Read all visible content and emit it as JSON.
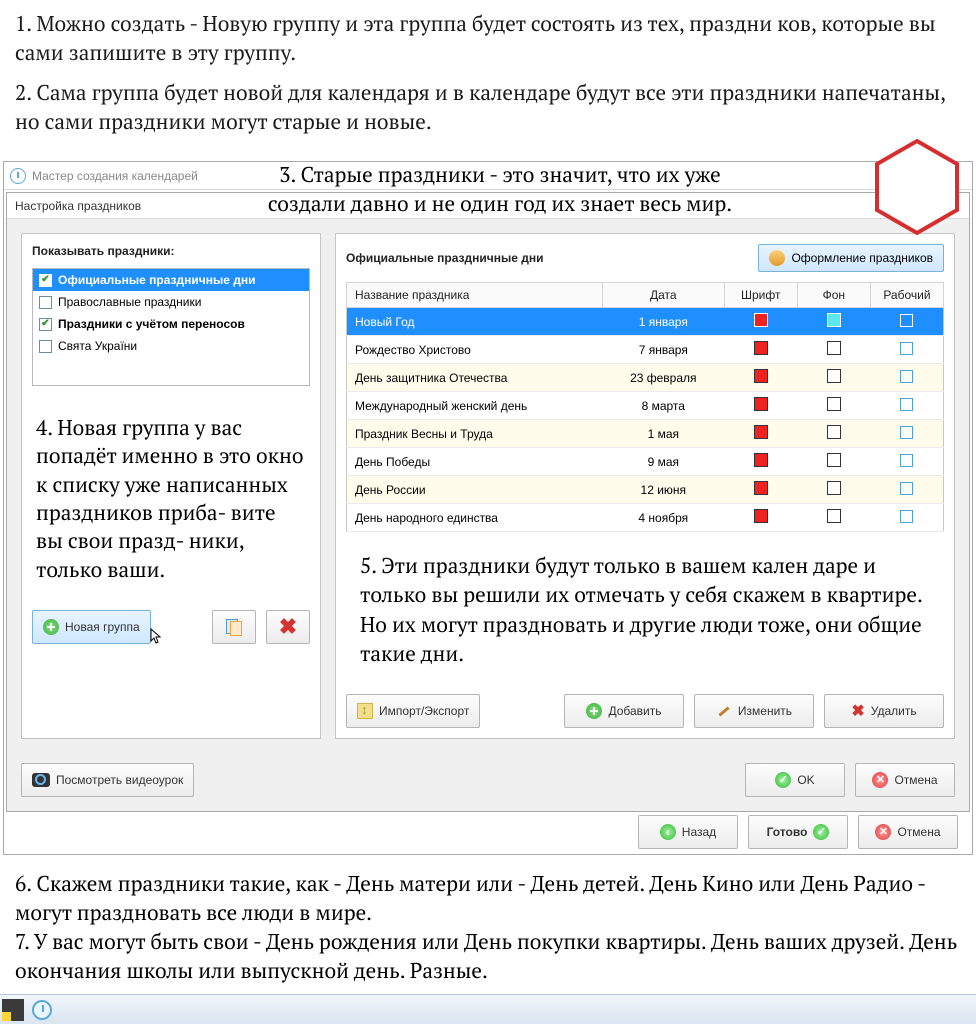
{
  "notes": {
    "n1": "1. Можно создать - Новую группу и эта группа будет состоять из тех, праздни ков, которые вы сами запишите в эту группу.",
    "n2": "2. Сама группа будет новой для календаря и в календаре будут все эти праздники напечатаны, но сами праздники могут старые и новые.",
    "n3a": "3. Старые праздники - это значит, что их уже",
    "n3b": "создали давно и не один год их знает весь мир.",
    "n4": "4. Новая группа у вас попадёт именно в это окно к списку уже написанных праздников приба- вите вы свои празд- ники, только ваши.",
    "n5": "5. Эти праздники будут только в вашем кален даре и только вы решили их отмечать у себя скажем в квартире. Но их могут праздновать и другие люди тоже, они общие такие дни.",
    "n6": "6. Скажем праздники такие, как - День матери или - День детей. День Кино или День Радио - могут праздновать все люди в мире.",
    "n7": "7. У вас могут быть свои - День рождения или День покупки квартиры. День ваших друзей. День окончания школы или выпускной день. Разные."
  },
  "outer": {
    "title": "Мастер создания календарей",
    "back": "Назад",
    "ready": "Готово",
    "cancel": "Отмена"
  },
  "inner": {
    "title": "Настройка праздников"
  },
  "left": {
    "heading": "Показывать праздники:",
    "groups": [
      {
        "label": "Официальные праздничные дни",
        "checked": true,
        "selected": true,
        "bold": true
      },
      {
        "label": "Православные праздники",
        "checked": false,
        "selected": false,
        "bold": false
      },
      {
        "label": "Праздники с учётом переносов",
        "checked": true,
        "selected": false,
        "bold": true
      },
      {
        "label": "Свята України",
        "checked": false,
        "selected": false,
        "bold": false
      }
    ],
    "newgroup": "Новая группа",
    "video": "Посмотреть видеоурок"
  },
  "right": {
    "heading": "Официальные праздничные дни",
    "stylebtn": "Оформление праздников",
    "cols": {
      "name": "Название праздника",
      "date": "Дата",
      "font": "Шрифт",
      "bg": "Фон",
      "work": "Рабочий"
    },
    "rows": [
      {
        "name": "Новый Год",
        "date": "1 января",
        "sel": true
      },
      {
        "name": "Рождество Христово",
        "date": "7 января"
      },
      {
        "name": "День защитника Отечества",
        "date": "23 февраля",
        "alt": true
      },
      {
        "name": "Международный женский день",
        "date": "8 марта"
      },
      {
        "name": "Праздник Весны и Труда",
        "date": "1 мая",
        "alt": true
      },
      {
        "name": "День Победы",
        "date": "9 мая"
      },
      {
        "name": "День России",
        "date": "12 июня",
        "alt": true
      },
      {
        "name": "День народного единства",
        "date": "4 ноября"
      }
    ],
    "impex": "Импорт/Экспорт",
    "add": "Добавить",
    "edit": "Изменить",
    "del": "Удалить",
    "ok": "OK",
    "cancel": "Отмена"
  }
}
